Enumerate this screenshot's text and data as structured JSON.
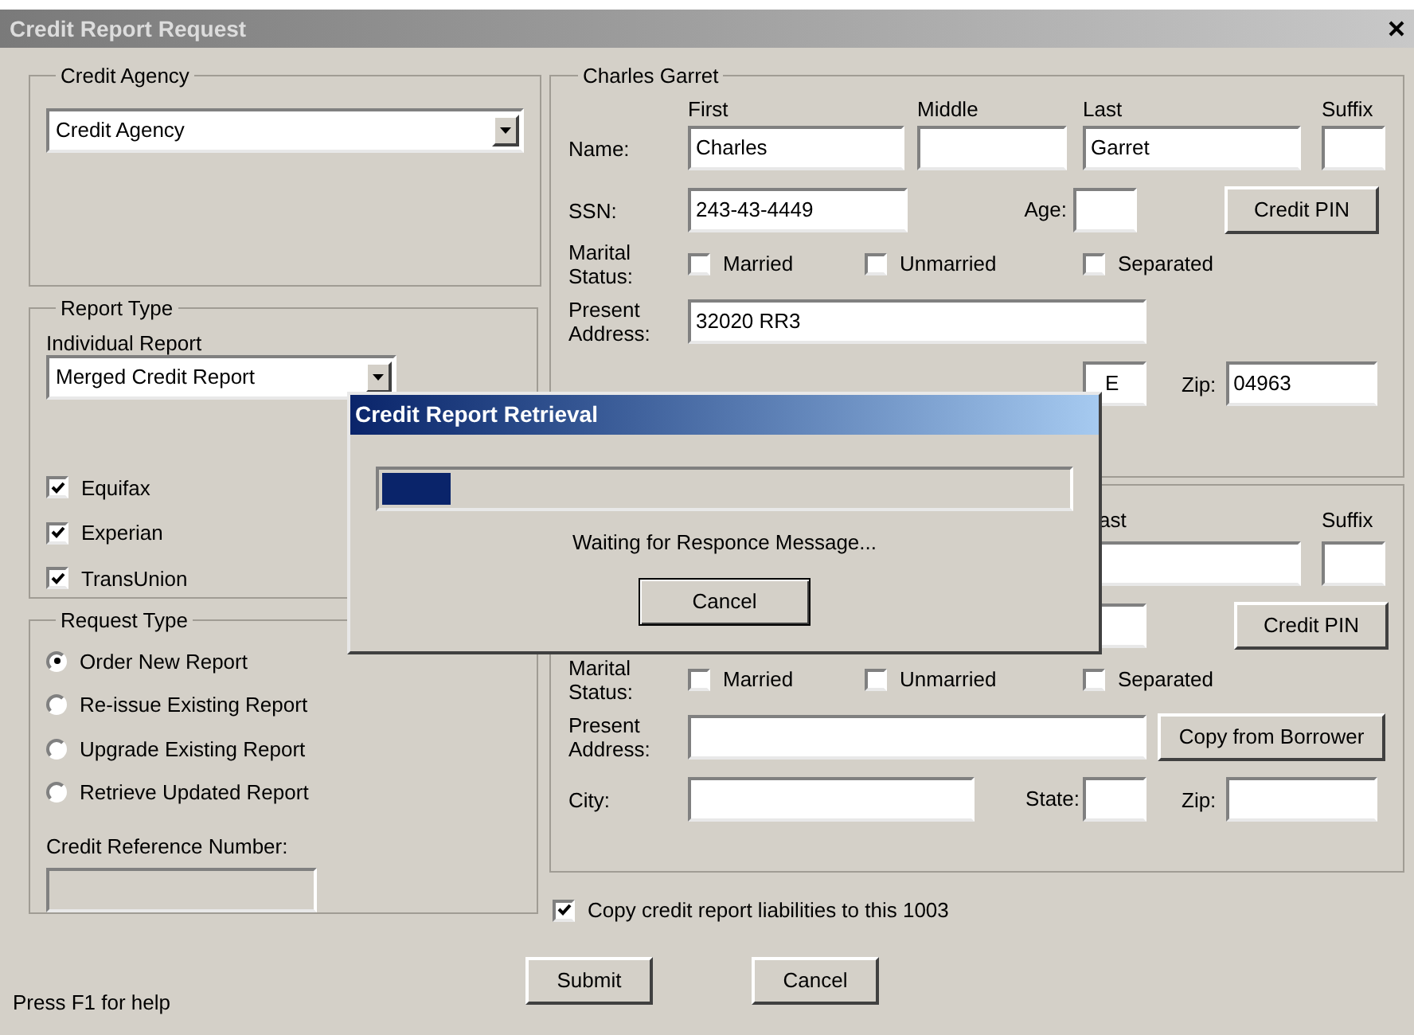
{
  "window": {
    "title": "Credit Report Request"
  },
  "credit_agency": {
    "legend": "Credit Agency",
    "value": "Credit Agency"
  },
  "report_type": {
    "legend": "Report Type",
    "label": "Individual Report",
    "value": "Merged Credit Report",
    "bureaus": [
      {
        "label": "Equifax",
        "checked": true
      },
      {
        "label": "Experian",
        "checked": true
      },
      {
        "label": "TransUnion",
        "checked": true
      }
    ]
  },
  "request_type": {
    "legend": "Request Type",
    "options": [
      {
        "label": "Order New Report",
        "selected": true
      },
      {
        "label": "Re-issue Existing Report",
        "selected": false
      },
      {
        "label": "Upgrade Existing Report",
        "selected": false
      },
      {
        "label": "Retrieve Updated Report",
        "selected": false
      }
    ],
    "reference_label": "Credit Reference Number:",
    "reference_disabled": true
  },
  "borrower": {
    "legend": "Charles Garret",
    "column_headings": [
      "First",
      "Middle",
      "Last",
      "Suffix"
    ],
    "name_label": "Name:",
    "first": "Charles",
    "last": "Garret",
    "ssn_label": "SSN:",
    "ssn": "243-43-4449",
    "age_label": "Age:",
    "pin_button": "Credit PIN",
    "marital_label": "Marital Status:",
    "marital_options": [
      {
        "label": "Married",
        "checked": false
      },
      {
        "label": "Unmarried",
        "checked": false
      },
      {
        "label": "Separated",
        "checked": false
      }
    ],
    "address_label": "Present Address:",
    "address": "32020 RR3",
    "state": "E",
    "zip_label": "Zip:",
    "zip": "04963"
  },
  "co_borrower": {
    "column_headings": [
      "ast",
      "Suffix"
    ],
    "pin_button": "Credit PIN",
    "marital_label": "Marital Status:",
    "marital_options": [
      {
        "label": "Married",
        "checked": false
      },
      {
        "label": "Unmarried",
        "checked": false
      },
      {
        "label": "Separated",
        "checked": false
      }
    ],
    "address_label": "Present Address:",
    "copy_button": "Copy from Borrower",
    "city_label": "City:",
    "state_label": "State:",
    "zip_label": "Zip:"
  },
  "copy_liabilities": {
    "label": "Copy credit report liabilities to this 1003",
    "checked": true
  },
  "buttons": [
    "Submit",
    "Cancel"
  ],
  "status": "Press F1 for help",
  "dialog": {
    "title": "Credit Report Retrieval",
    "level": 0.1,
    "message": "Waiting for Responce Message...",
    "button": "Cancel"
  }
}
